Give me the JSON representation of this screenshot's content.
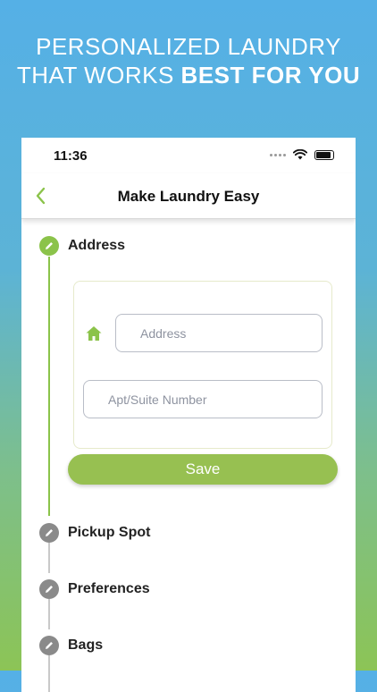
{
  "headline": {
    "line1": "PERSONALIZED LAUNDRY",
    "line2_prefix": "THAT WORKS ",
    "line2_bold": "BEST FOR YOU"
  },
  "status_bar": {
    "time": "11:36"
  },
  "nav": {
    "title": "Make Laundry Easy",
    "back_icon": "chevron-left-icon"
  },
  "steps": [
    {
      "label": "Address",
      "state": "active"
    },
    {
      "label": "Pickup Spot",
      "state": "inactive"
    },
    {
      "label": "Preferences",
      "state": "inactive"
    },
    {
      "label": "Bags",
      "state": "inactive"
    }
  ],
  "address_form": {
    "address_placeholder": "Address",
    "apt_placeholder": "Apt/Suite Number",
    "save_label": "Save"
  },
  "colors": {
    "accent_green": "#8bc34a",
    "save_button": "#97c051",
    "inactive_step": "#8a8a8a"
  }
}
